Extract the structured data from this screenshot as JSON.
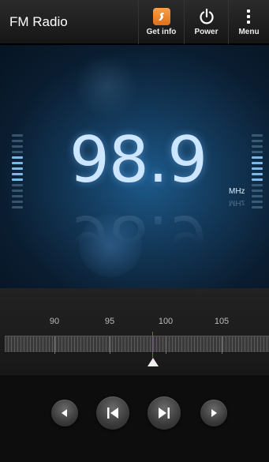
{
  "header": {
    "title": "FM Radio",
    "actions": [
      {
        "label": "Get info",
        "icon": "get-info-icon"
      },
      {
        "label": "Power",
        "icon": "power-icon"
      },
      {
        "label": "Menu",
        "icon": "overflow-menu-icon"
      }
    ]
  },
  "display": {
    "frequency": "98.9",
    "unit": "MHz"
  },
  "tuner": {
    "scale_labels": [
      "90",
      "95",
      "100",
      "105"
    ],
    "current_frequency_mhz": 98.9,
    "needle_color": "#d43a2a"
  },
  "controls": [
    {
      "name": "seek-down",
      "icon": "triangle-left-icon"
    },
    {
      "name": "previous-preset",
      "icon": "skip-previous-icon"
    },
    {
      "name": "next-preset",
      "icon": "skip-next-icon"
    },
    {
      "name": "seek-up",
      "icon": "triangle-right-icon"
    }
  ],
  "colors": {
    "accent": "#e0701a",
    "frequency_text": "#cde6ff",
    "level_bar": "#7ab8e8"
  }
}
